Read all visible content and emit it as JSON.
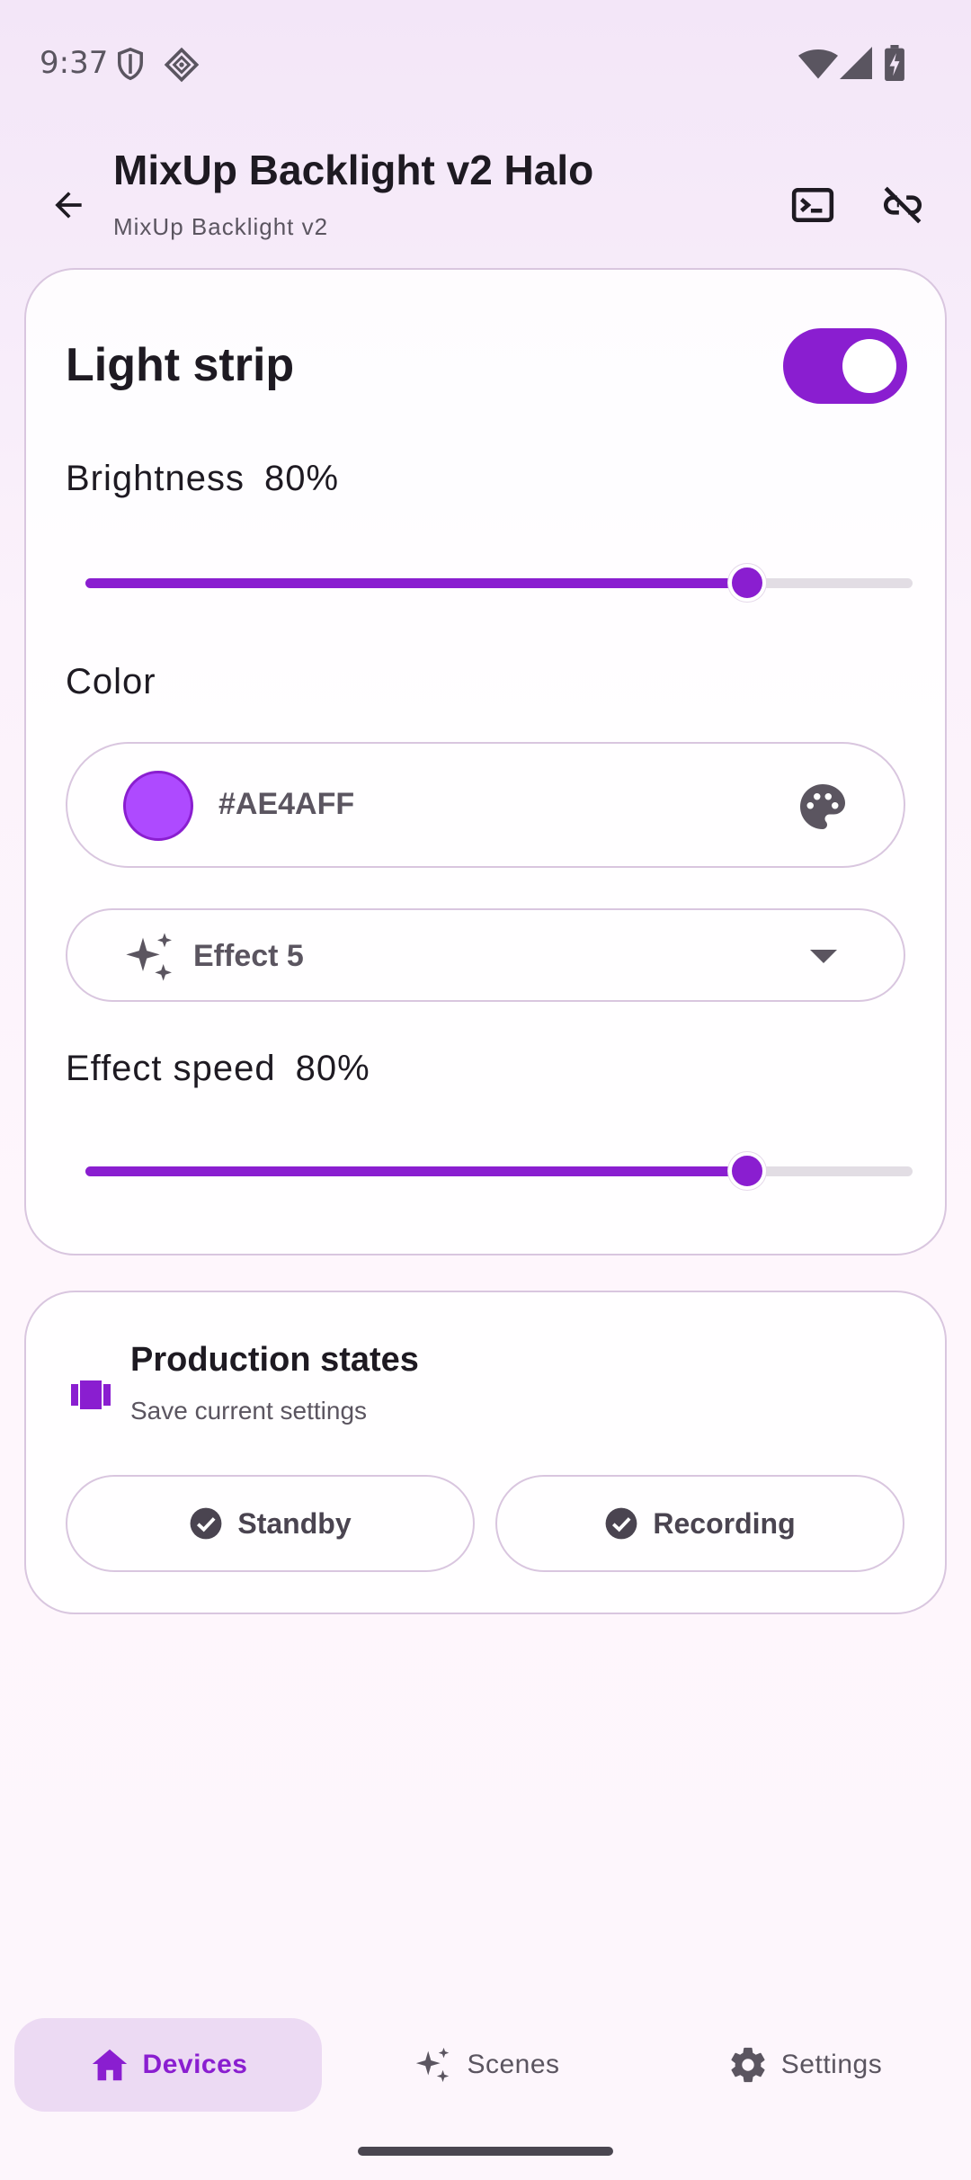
{
  "status_bar": {
    "time": "9:37"
  },
  "app_bar": {
    "title": "MixUp Backlight v2 Halo",
    "subtitle": "MixUp Backlight v2"
  },
  "light_strip": {
    "title": "Light strip",
    "power_on": true,
    "brightness": {
      "label": "Brightness",
      "value_text": "80%",
      "value": 0.8
    },
    "color": {
      "label": "Color",
      "hex": "#AE4AFF"
    },
    "effect": {
      "selected": "Effect 5"
    },
    "effect_speed": {
      "label": "Effect speed",
      "value_text": "80%",
      "value": 0.8
    }
  },
  "production_states": {
    "title": "Production states",
    "subtitle": "Save current settings",
    "buttons": [
      {
        "label": "Standby"
      },
      {
        "label": "Recording"
      }
    ]
  },
  "bottom_nav": {
    "items": [
      {
        "label": "Devices",
        "icon": "home-icon",
        "active": true
      },
      {
        "label": "Scenes",
        "icon": "sparkle-icon",
        "active": false
      },
      {
        "label": "Settings",
        "icon": "gear-icon",
        "active": false
      }
    ]
  },
  "colors": {
    "accent": "#8A1ED0",
    "swatch": "#AE4AFF"
  }
}
